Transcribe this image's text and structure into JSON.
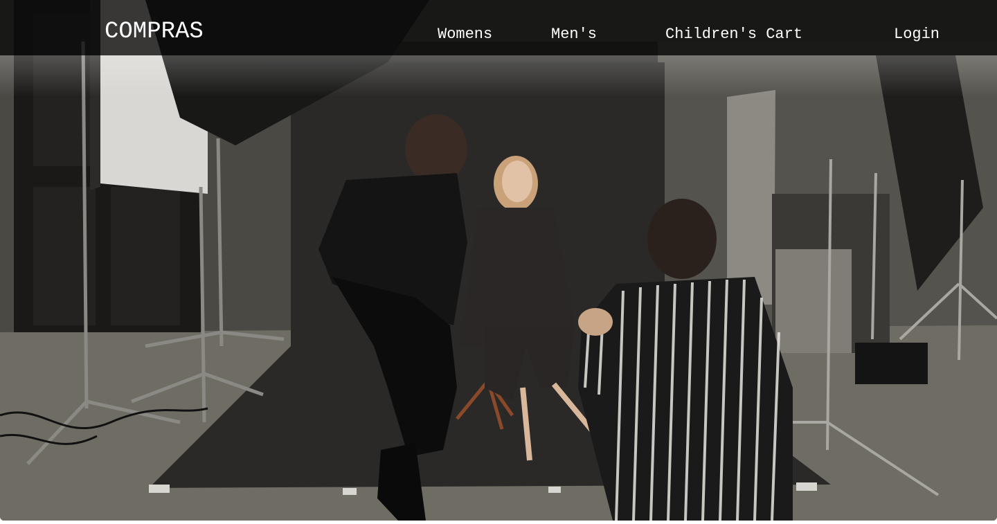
{
  "header": {
    "brand": "COMPRAS",
    "nav": {
      "womens": "Womens",
      "mens": "Men's",
      "children_cart": "Children's Cart",
      "login": "Login"
    }
  },
  "hero": {
    "image": "photo-studio-fashion-shoot-image"
  },
  "colors": {
    "navbar_bg": "#0a0a0a",
    "nav_text": "#ffffff"
  }
}
